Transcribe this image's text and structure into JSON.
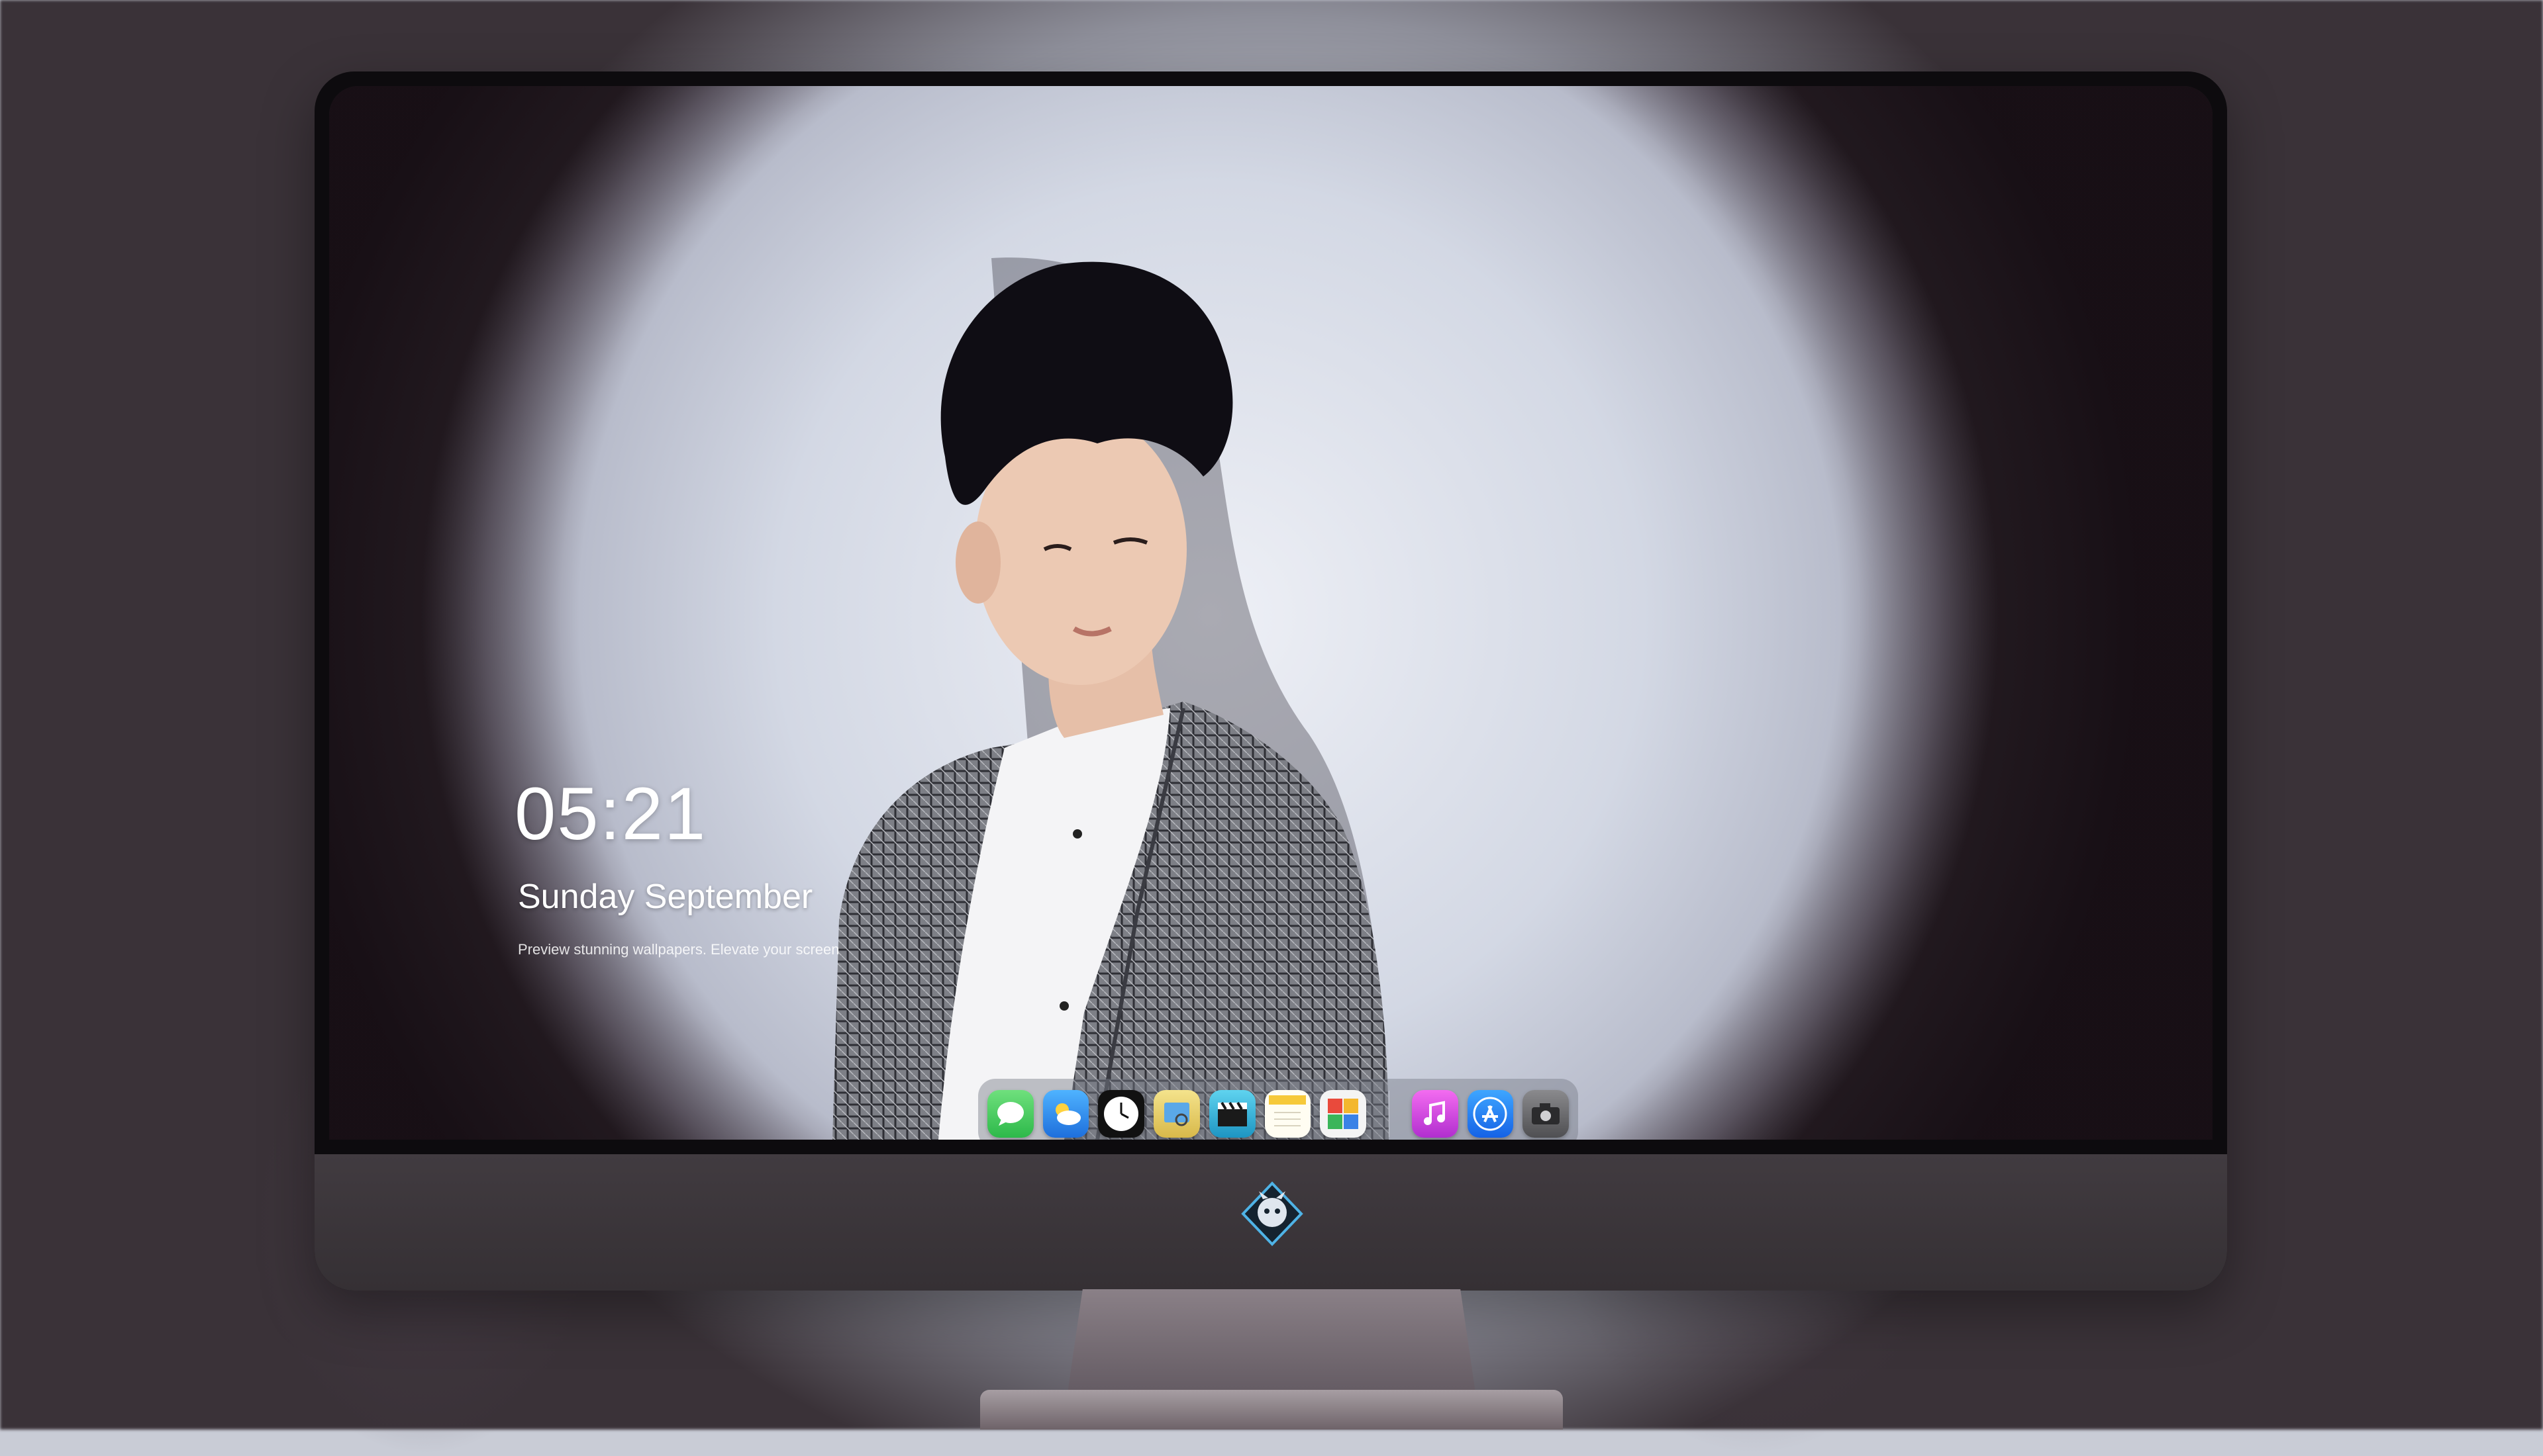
{
  "lockscreen": {
    "time": "05:21",
    "date": "Sunday September",
    "tagline": "Preview stunning wallpapers. Elevate your screen"
  },
  "dock": {
    "apps": [
      {
        "name": "Messages",
        "icon": "messages-icon",
        "color": "#34c759"
      },
      {
        "name": "Weather",
        "icon": "weather-icon",
        "color": "#2f8ef0"
      },
      {
        "name": "Clock",
        "icon": "clock-icon",
        "color": "#111111"
      },
      {
        "name": "Preview",
        "icon": "preview-icon",
        "color": "#e6d36a"
      },
      {
        "name": "Clips",
        "icon": "clapperboard-icon",
        "color": "#2fb3d9"
      },
      {
        "name": "Notes",
        "icon": "notes-icon",
        "color": "#f6d24a"
      },
      {
        "name": "Photos",
        "icon": "photos-grid-icon",
        "color": "#f3f3f3"
      }
    ],
    "apps_right": [
      {
        "name": "iTunes",
        "icon": "music-note-icon",
        "color": "#d94cd6"
      },
      {
        "name": "App Store",
        "icon": "app-store-icon",
        "color": "#1e7bf2"
      },
      {
        "name": "Camera",
        "icon": "camera-icon",
        "color": "#6d6d6f"
      }
    ]
  },
  "colors": {
    "monitor_bezel": "#0d0b0e",
    "monitor_chin": "#3b3539",
    "backdrop": "#cfd2dc"
  }
}
